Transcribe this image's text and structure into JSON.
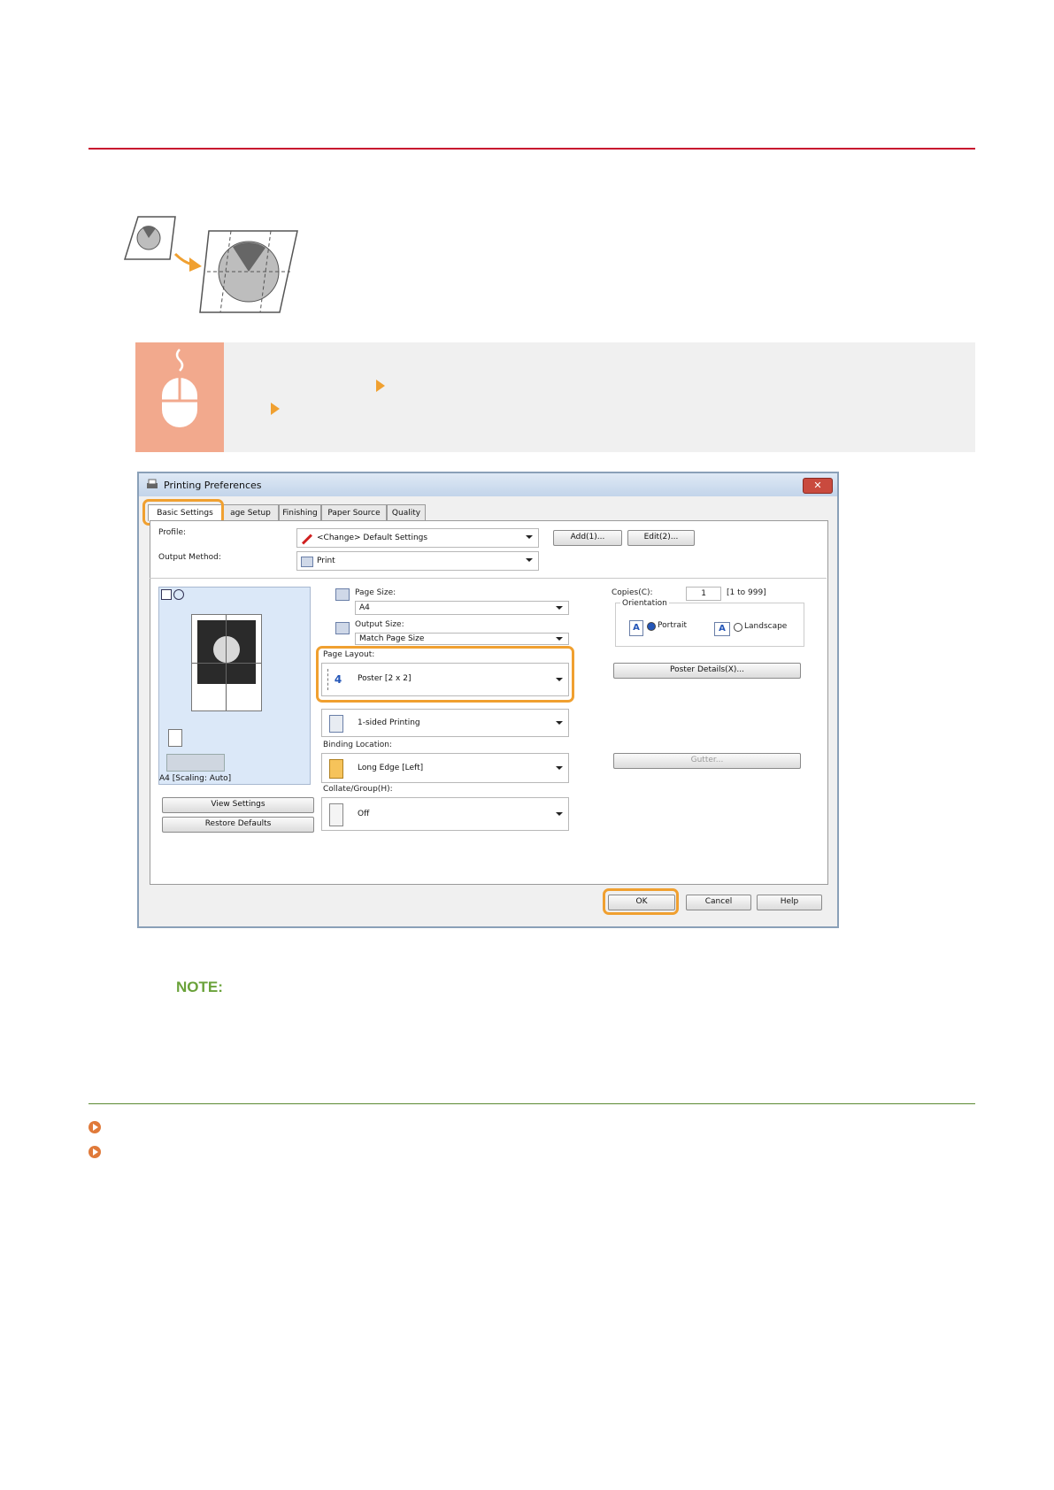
{
  "dialog": {
    "title": "Printing Preferences",
    "close_label": "✕",
    "tabs": [
      "Basic Settings",
      "age Setup",
      "Finishing",
      "Paper Source",
      "Quality"
    ],
    "profile_label": "Profile:",
    "profile_value": "<Change> Default Settings",
    "add_button": "Add(1)...",
    "edit_button": "Edit(2)...",
    "output_method_label": "Output Method:",
    "output_method_value": "Print",
    "page_size_label": "Page Size:",
    "page_size_value": "A4",
    "output_size_label": "Output Size:",
    "output_size_value": "Match Page Size",
    "copies_label": "Copies(C):",
    "copies_value": "1",
    "copies_range": "[1 to 999]",
    "orientation_label": "Orientation",
    "portrait_label": "Portrait",
    "landscape_label": "Landscape",
    "page_layout_label": "Page Layout:",
    "page_layout_value": "Poster [2 x 2]",
    "poster_details_button": "Poster Details(X)...",
    "printing_value": "1-sided Printing",
    "binding_label": "Binding Location:",
    "binding_value": "Long Edge [Left]",
    "gutter_button": "Gutter...",
    "collate_label": "Collate/Group(H):",
    "collate_value": "Off",
    "preview_caption": "A4 [Scaling: Auto]",
    "view_settings_button": "View Settings",
    "restore_defaults_button": "Restore Defaults",
    "ok_button": "OK",
    "cancel_button": "Cancel",
    "help_button": "Help",
    "page_layout_icon_text": "4"
  },
  "note": {
    "label": "NOTE:"
  },
  "colors": {
    "accent": "#f0a030",
    "rule_red": "#c8102e",
    "rule_green": "#5b8a32",
    "note_green": "#6aa23a",
    "mouse_panel": "#f2a98d"
  }
}
